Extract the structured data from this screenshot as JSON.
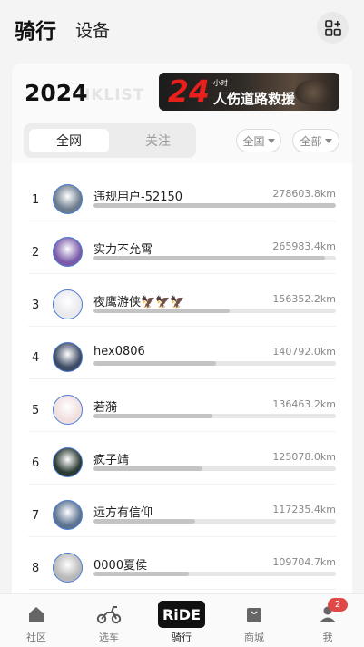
{
  "header": {
    "tab_active": "骑行",
    "tab_other": "设备",
    "action_icon": "grid-plus-icon"
  },
  "card": {
    "year": "2024",
    "watermark": "NKLIST",
    "banner": {
      "number": "24",
      "small_text": "小时",
      "text": "人伤道路救援"
    },
    "segments": {
      "active": "全网",
      "inactive": "关注"
    },
    "filters": {
      "region": "全国",
      "type": "全部"
    }
  },
  "ranking": [
    {
      "rank": "1",
      "name": "违规用户-52150",
      "distance": "278603.8km",
      "fill": 1.0,
      "avatar_color": "#6b7b8c"
    },
    {
      "rank": "2",
      "name": "实力不允霄",
      "distance": "265983.4km",
      "fill": 0.955,
      "avatar_color": "#7a5aa8"
    },
    {
      "rank": "3",
      "name": "夜鹰游侠🦅🦅🦅",
      "distance": "156352.2km",
      "fill": 0.56,
      "avatar_color": "#e9e9ee"
    },
    {
      "rank": "4",
      "name": "hex0806",
      "distance": "140792.0km",
      "fill": 0.505,
      "avatar_color": "#3d4a63"
    },
    {
      "rank": "5",
      "name": "若漪",
      "distance": "136463.2km",
      "fill": 0.49,
      "avatar_color": "#f1dede"
    },
    {
      "rank": "6",
      "name": "疯子靖",
      "distance": "125078.0km",
      "fill": 0.448,
      "avatar_color": "#2b3a32"
    },
    {
      "rank": "7",
      "name": "远方有信仰",
      "distance": "117235.4km",
      "fill": 0.42,
      "avatar_color": "#5b7290"
    },
    {
      "rank": "8",
      "name": "0000夏侯",
      "distance": "109704.7km",
      "fill": 0.394,
      "avatar_color": "#b8b8b8"
    }
  ],
  "bottom_nav": [
    {
      "label": "社区",
      "icon": "home-icon"
    },
    {
      "label": "选车",
      "icon": "scooter-icon"
    },
    {
      "label": "骑行",
      "icon": "ride-logo-icon",
      "logo_text": "RiDE"
    },
    {
      "label": "商城",
      "icon": "shopping-bag-icon"
    },
    {
      "label": "我",
      "icon": "profile-icon",
      "badge": "2"
    }
  ]
}
